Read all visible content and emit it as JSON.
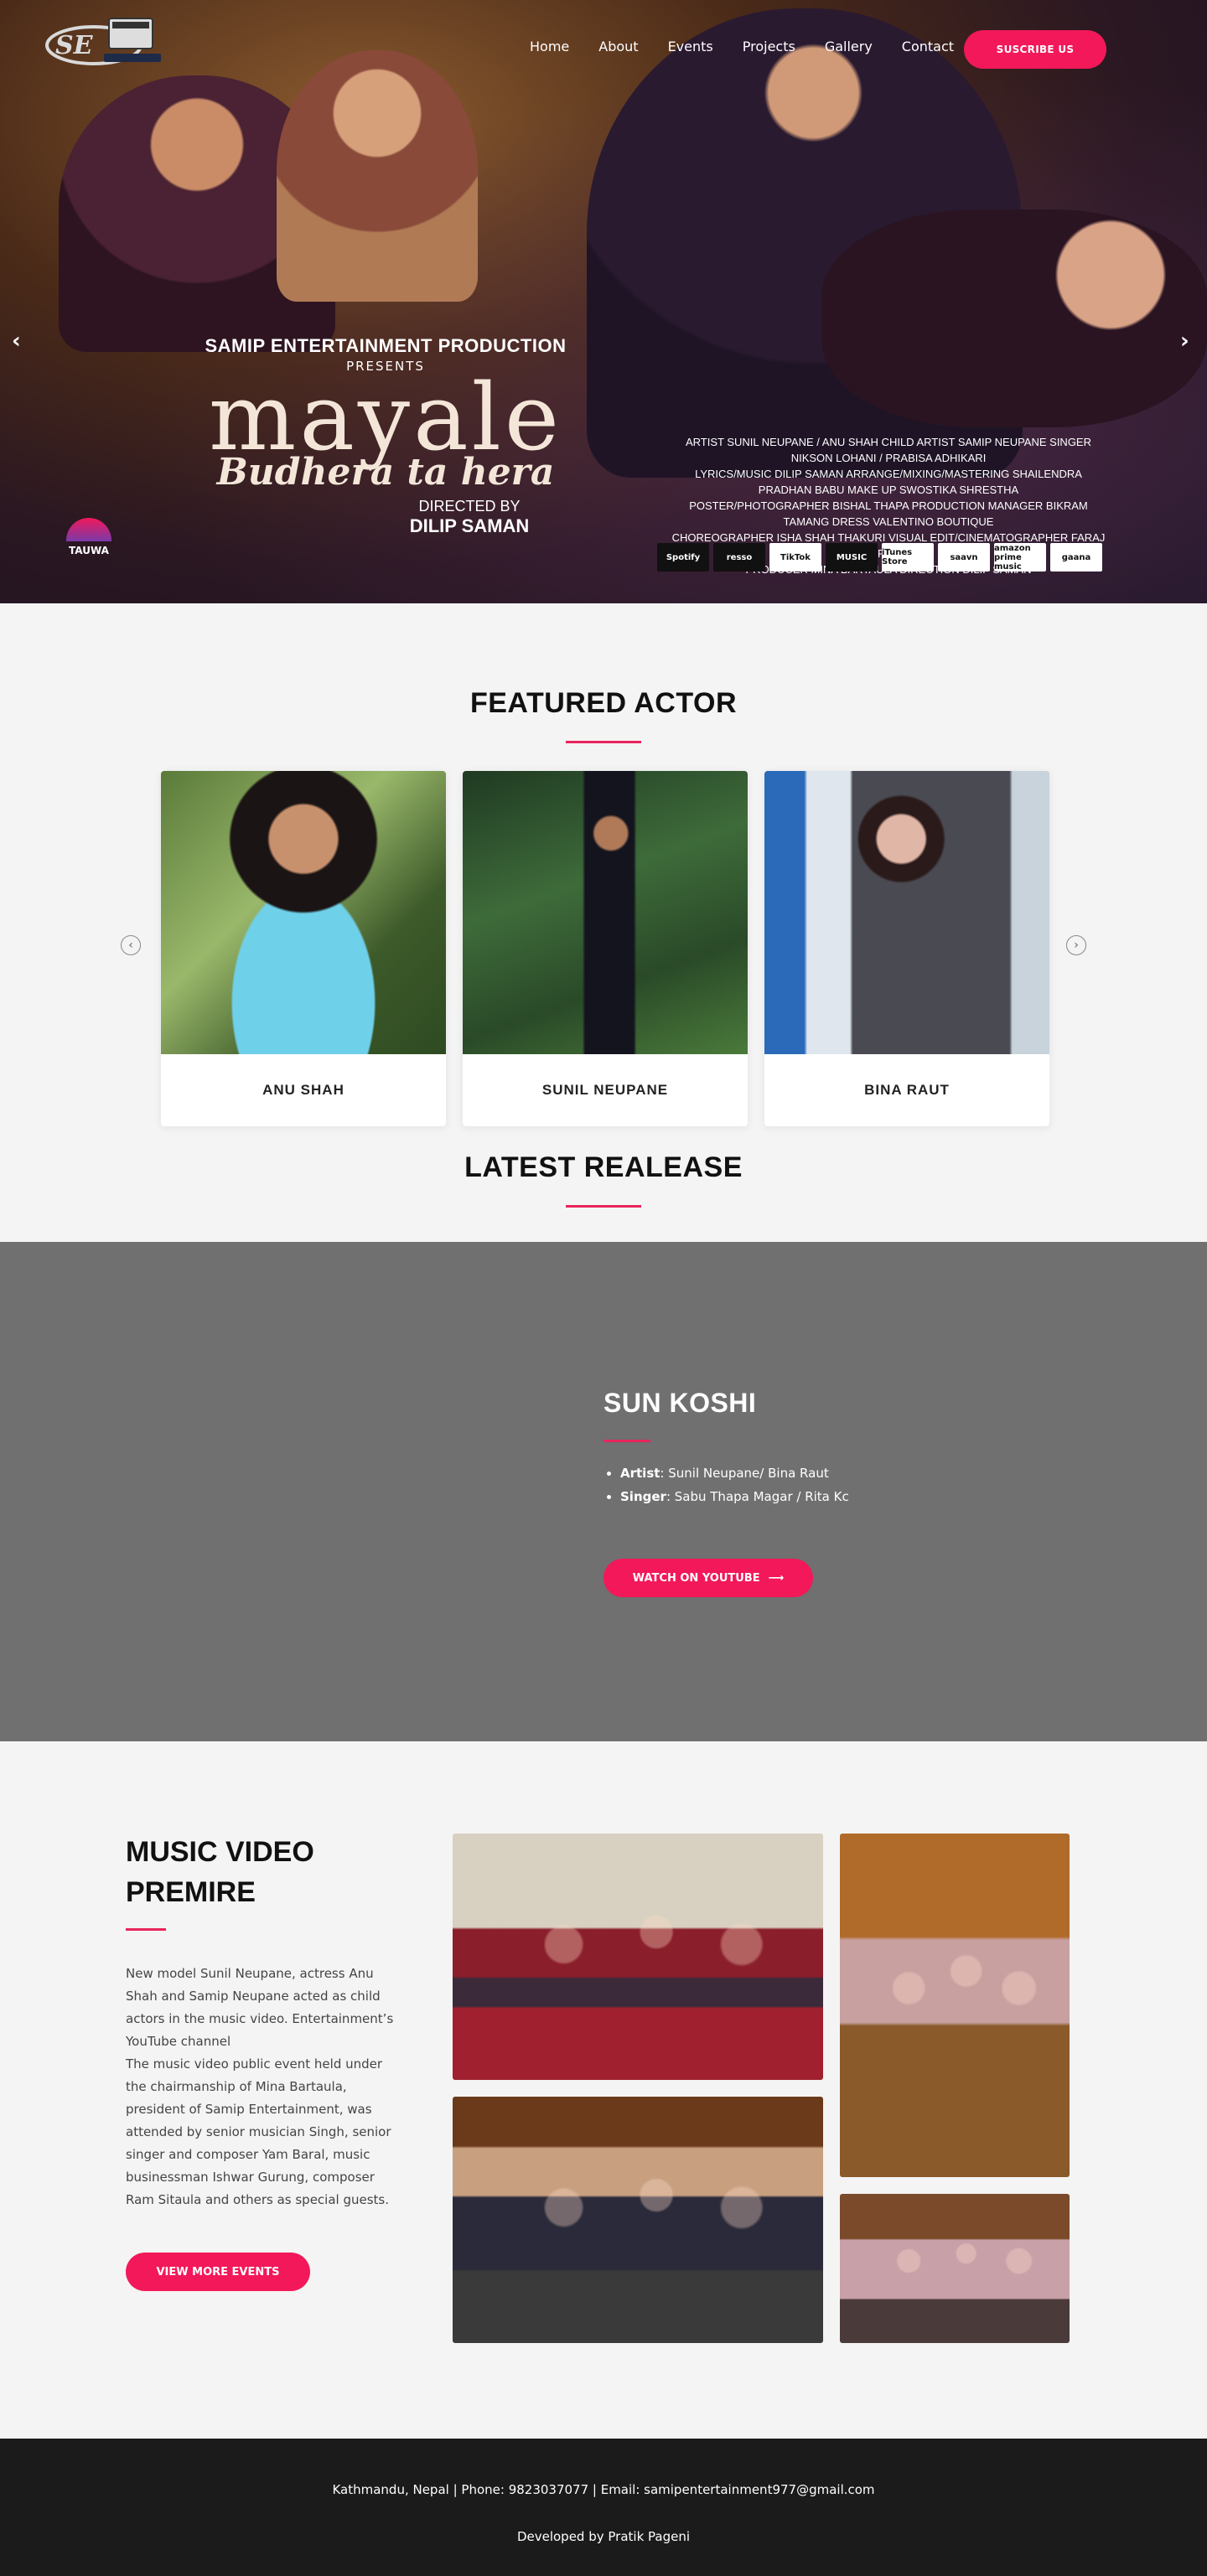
{
  "nav": {
    "items": [
      "Home",
      "About",
      "Events",
      "Projects",
      "Gallery",
      "Contact"
    ],
    "subscribe_label": "SUSCRIBE US"
  },
  "hero": {
    "production": "SAMIP ENTERTAINMENT PRODUCTION",
    "presents": "PRESENTS",
    "title_main": "mayale",
    "title_sub": "Budhera ta hera",
    "directed_by": "DIRECTED BY",
    "director": "DILIP SAMAN",
    "credits": [
      "ARTIST SUNIL NEUPANE / ANU SHAH  CHILD ARTIST SAMIP NEUPANE  SINGER NIKSON LOHANI / PRABISA ADHIKARI",
      "LYRICS/MUSIC DILIP SAMAN  ARRANGE/MIXING/MASTERING SHAILENDRA PRADHAN BABU  MAKE UP SWOSTIKA SHRESTHA",
      "POSTER/PHOTOGRAPHER BISHAL THAPA  PRODUCTION MANAGER BIKRAM TAMANG  DRESS VALENTINO BOUTIQUE",
      "CHOREOGRAPHER ISHA SHAH THAKURI  VISUAL EDIT/CINEMATOGRAPHER FARAJ ARFAN",
      "PRODUCER MINA BARTAULA  DIRECTION DILIP SAMAN"
    ],
    "platforms": [
      "Spotify",
      "resso",
      "TikTok",
      "MUSIC",
      "iTunes Store",
      "saavn",
      "amazon prime music",
      "gaana"
    ],
    "tauwa": "TAUWA"
  },
  "featured": {
    "title": "FEATURED ACTOR",
    "actors": [
      "ANU SHAH",
      "SUNIL NEUPANE",
      "BINA RAUT"
    ]
  },
  "latest": {
    "title": "LATEST REALEASE",
    "song": "SUN KOSHI",
    "artist_label": "Artist",
    "artist_value": ": Sunil Neupane/ Bina Raut",
    "singer_label": "Singer",
    "singer_value": ":  Sabu Thapa Magar / Rita Kc",
    "button": "WATCH ON YOUTUBE"
  },
  "premire": {
    "title": "MUSIC VIDEO PREMIRE",
    "text": "New model Sunil Neupane, actress Anu Shah and Samip Neupane acted as child actors in the music video. Entertainment’s YouTube channel\nThe music video public event held under the chairmanship of Mina Bartaula, president of Samip Entertainment, was attended by senior musician Singh, senior singer and composer Yam Baral, music businessman Ishwar Gurung, composer Ram Sitaula and others as special guests.",
    "button": "VIEW MORE EVENTS"
  },
  "footer": {
    "contact": "Kathmandu, Nepal | Phone: 9823037077 | Email: samipentertainment977@gmail.com",
    "developer": "Developed by Pratik Pageni"
  },
  "colors": {
    "accent": "#f2185a",
    "footer_bg": "#1b1b1b",
    "release_bg": "#707070"
  }
}
